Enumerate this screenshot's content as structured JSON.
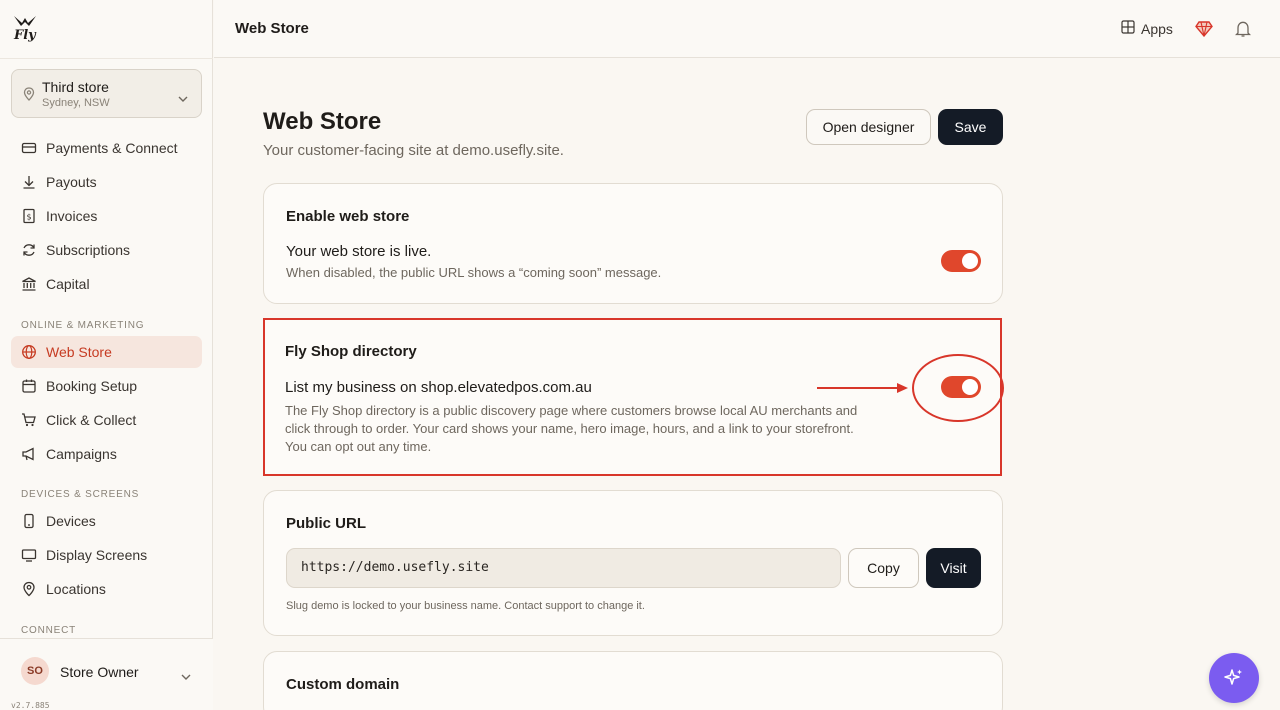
{
  "brand": {
    "logo_text": "Fly"
  },
  "store": {
    "name": "Third store",
    "location": "Sydney, NSW"
  },
  "sidebar": {
    "items_top": [
      {
        "label": "Payments & Connect",
        "icon": "card-icon"
      },
      {
        "label": "Payouts",
        "icon": "download-icon"
      },
      {
        "label": "Invoices",
        "icon": "receipt-icon"
      },
      {
        "label": "Subscriptions",
        "icon": "refresh-icon"
      },
      {
        "label": "Capital",
        "icon": "bank-icon"
      }
    ],
    "section_online": "ONLINE & MARKETING",
    "items_online": [
      {
        "label": "Web Store",
        "icon": "globe-icon",
        "active": true
      },
      {
        "label": "Booking Setup",
        "icon": "calendar-icon"
      },
      {
        "label": "Click & Collect",
        "icon": "cart-icon"
      },
      {
        "label": "Campaigns",
        "icon": "megaphone-icon"
      }
    ],
    "section_devices": "DEVICES & SCREENS",
    "items_devices": [
      {
        "label": "Devices",
        "icon": "phone-icon"
      },
      {
        "label": "Display Screens",
        "icon": "display-icon"
      },
      {
        "label": "Locations",
        "icon": "location-pin-icon"
      }
    ],
    "section_connect": "CONNECT",
    "owner": {
      "initials": "SO",
      "name": "Store Owner"
    },
    "version": "v2.7.885"
  },
  "topbar": {
    "title": "Web Store",
    "apps_label": "Apps"
  },
  "page": {
    "title": "Web Store",
    "subtitle": "Your customer-facing site at demo.usefly.site.",
    "open_designer_label": "Open designer",
    "save_label": "Save"
  },
  "enable_card": {
    "title": "Enable web store",
    "row_title": "Your web store is live.",
    "row_desc": "When disabled, the public URL shows a “coming soon” message.",
    "toggle_on": true
  },
  "directory_card": {
    "title": "Fly Shop directory",
    "row_title": "List my business on shop.elevatedpos.com.au",
    "desc_line1": "The Fly Shop directory is a public discovery page where customers browse local AU merchants and",
    "desc_line2": "click through to order. Your card shows your name, hero image, hours, and a link to your storefront.",
    "desc_line3": "You can opt out any time.",
    "toggle_on": true
  },
  "url_card": {
    "title": "Public URL",
    "url_value": "https://demo.usefly.site",
    "copy_label": "Copy",
    "visit_label": "Visit",
    "slug_note": "Slug demo is locked to your business name. Contact support to change it."
  },
  "domain_card": {
    "title": "Custom domain"
  },
  "colors": {
    "accent": "#e0472c",
    "dark": "#141b26",
    "annotation": "#d8362a",
    "fab": "#7b5cf0"
  }
}
